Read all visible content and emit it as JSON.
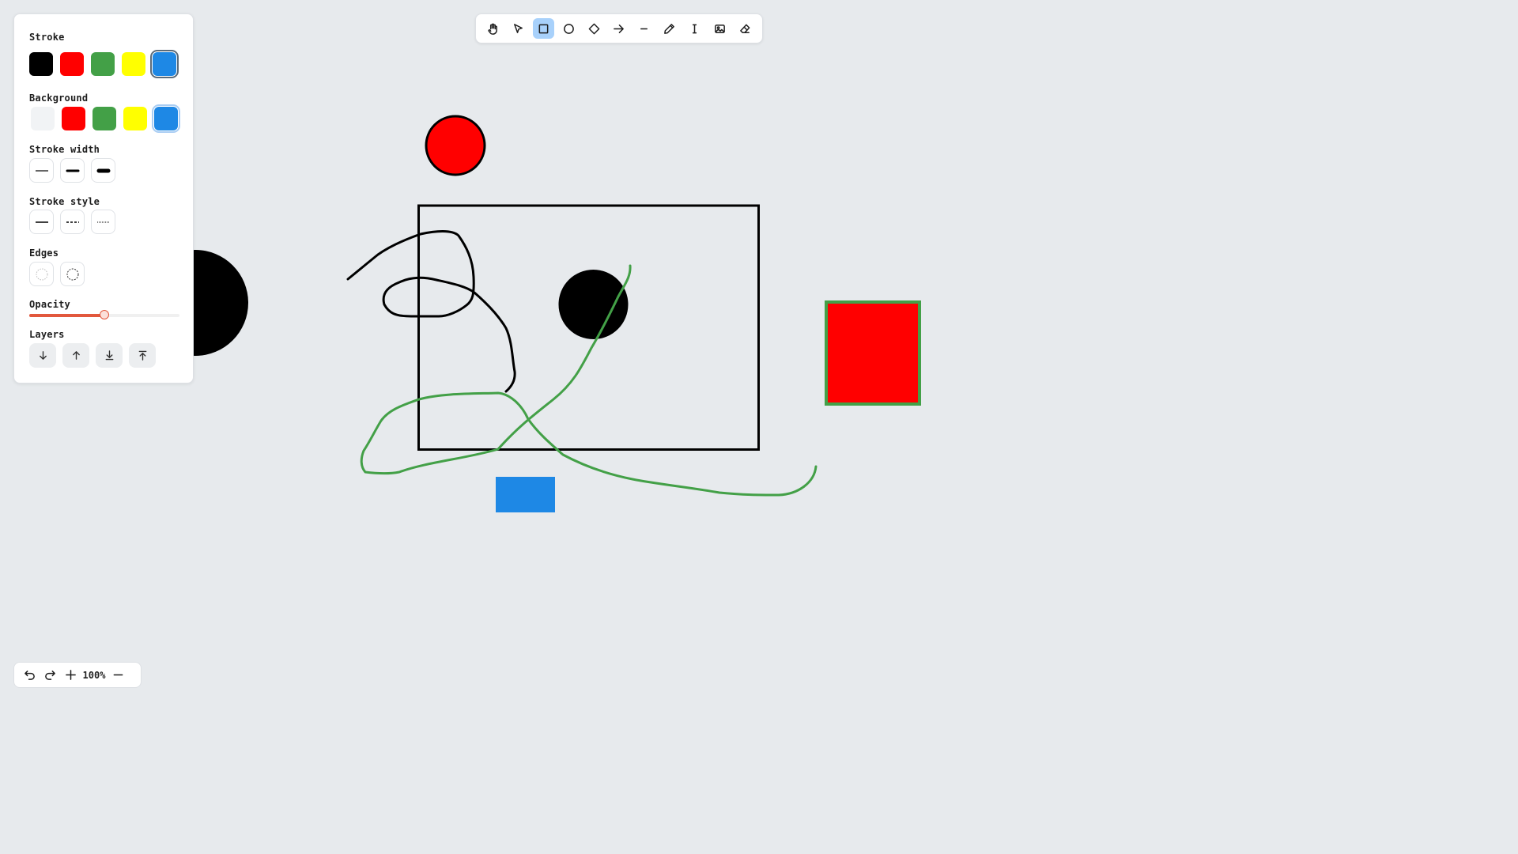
{
  "toolbar": {
    "tools": [
      {
        "name": "hand-tool",
        "icon": "hand-icon"
      },
      {
        "name": "select-tool",
        "icon": "pointer-icon"
      },
      {
        "name": "rectangle-tool",
        "icon": "square-icon",
        "active": true
      },
      {
        "name": "ellipse-tool",
        "icon": "circle-icon"
      },
      {
        "name": "diamond-tool",
        "icon": "diamond-icon"
      },
      {
        "name": "arrow-tool",
        "icon": "arrow-right-icon"
      },
      {
        "name": "line-tool",
        "icon": "line-icon"
      },
      {
        "name": "pencil-tool",
        "icon": "pencil-icon"
      },
      {
        "name": "text-tool",
        "icon": "text-cursor-icon"
      },
      {
        "name": "image-tool",
        "icon": "image-icon"
      },
      {
        "name": "eraser-tool",
        "icon": "eraser-icon"
      }
    ]
  },
  "panel": {
    "stroke_title": "Stroke",
    "stroke_colors": [
      "#000000",
      "#ff0000",
      "#43a047",
      "#ffff00",
      "#1e88e5"
    ],
    "stroke_selected": "#1e88e5",
    "background_title": "Background",
    "background_colors": [
      "#f1f3f5",
      "#ff0000",
      "#43a047",
      "#ffff00",
      "#1e88e5"
    ],
    "background_selected": "#1e88e5",
    "stroke_width_title": "Stroke width",
    "stroke_style_title": "Stroke style",
    "edges_title": "Edges",
    "opacity_title": "Opacity",
    "opacity_value": 0.5,
    "layers_title": "Layers"
  },
  "zoom": {
    "label": "100%"
  },
  "colors": {
    "canvas_bg": "#e7eaed",
    "accent": "#e2583d",
    "active_tool": "#a8d1fb",
    "green_stroke": "#43a047",
    "red_fill": "#ff0000",
    "blue_fill": "#1e88e5"
  }
}
